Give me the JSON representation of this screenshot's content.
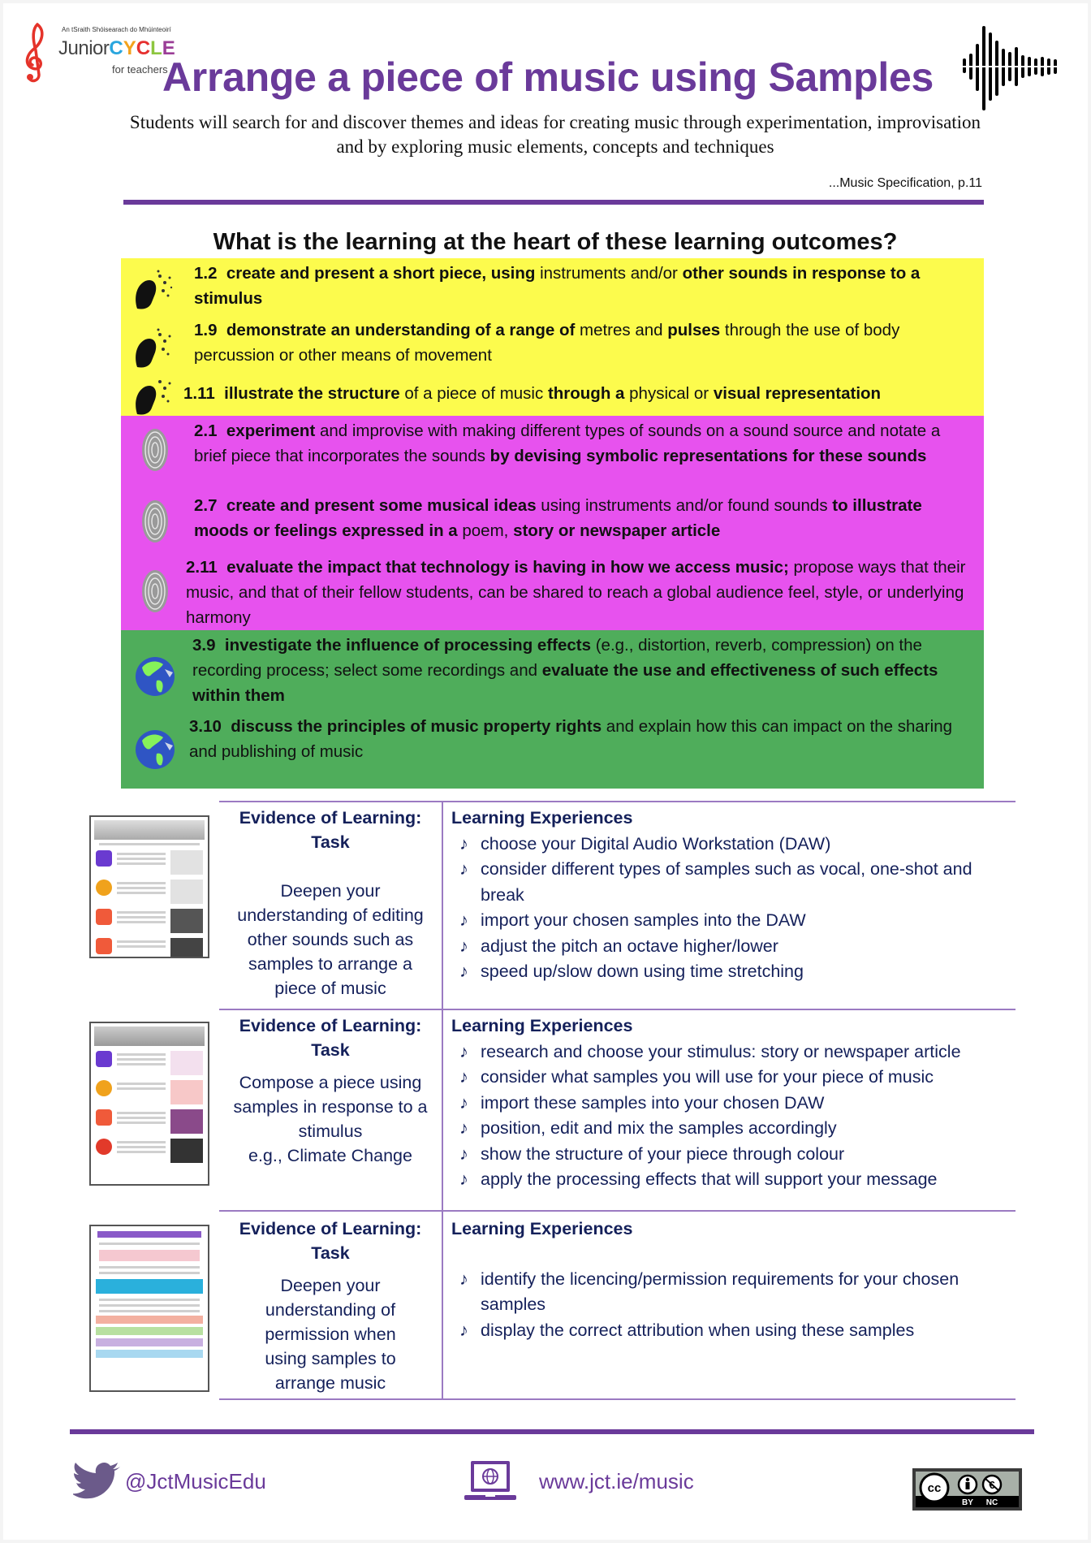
{
  "header": {
    "logo": {
      "irish_line": "An tSraith Shóisearach do Mhúinteoirí",
      "junior": "Junior",
      "cycle_letters": [
        "C",
        "Y",
        "C",
        "L",
        "E"
      ],
      "for_teachers": "for teachers"
    },
    "title": "Arrange a piece of music using Samples",
    "subtitle": "Students will search for and discover themes and ideas for creating music through experimentation, improvisation and by exploring music elements, concepts and techniques",
    "citation": "...Music Specification, p.11"
  },
  "question": "What is the learning at the heart of these learning outcomes?",
  "colors": {
    "brand_purple": "#6a3a9a",
    "strand1_yellow": "#fcfb4d",
    "strand2_pink": "#e752ee",
    "strand3_green": "#4fad5b",
    "table_text_navy": "#14205a",
    "table_rule_lilac": "#9b7ac2"
  },
  "outcomes": [
    {
      "strand": 1,
      "icon": "head-music-icon",
      "number": "1.2",
      "segments": [
        {
          "t": "create and present a short piece, using",
          "b": true
        },
        {
          "t": " instruments and/or ",
          "b": false
        },
        {
          "t": "other sounds in response to a stimulus",
          "b": true
        }
      ]
    },
    {
      "strand": 1,
      "icon": "head-music-icon",
      "number": "1.9",
      "segments": [
        {
          "t": "demonstrate an understanding of a range of",
          "b": true
        },
        {
          "t": " metres and ",
          "b": false
        },
        {
          "t": "pulses",
          "b": true
        },
        {
          "t": " through the use of body percussion or other means of movement",
          "b": false
        }
      ]
    },
    {
      "strand": 1,
      "icon": "head-music-icon",
      "number": "1.11",
      "segments": [
        {
          "t": "illustrate the structure",
          "b": true
        },
        {
          "t": " of a piece of music ",
          "b": false
        },
        {
          "t": "through a",
          "b": true
        },
        {
          "t": " physical or ",
          "b": false
        },
        {
          "t": "visual representation",
          "b": true
        }
      ]
    },
    {
      "strand": 2,
      "icon": "fingerprint-icon",
      "number": "2.1",
      "segments": [
        {
          "t": "experiment",
          "b": true
        },
        {
          "t": " and improvise with making different types of sounds on a sound source and notate a brief piece that incorporates the sounds ",
          "b": false
        },
        {
          "t": "by devising symbolic representations for these sounds",
          "b": true
        }
      ]
    },
    {
      "strand": 2,
      "icon": "fingerprint-icon",
      "number": "2.7",
      "segments": [
        {
          "t": "create and present some musical ideas",
          "b": true
        },
        {
          "t": " using instruments and/or found sounds ",
          "b": false
        },
        {
          "t": "to illustrate moods or feelings expressed in a",
          "b": true
        },
        {
          "t": " poem, ",
          "b": false
        },
        {
          "t": "story or newspaper article",
          "b": true
        }
      ]
    },
    {
      "strand": 2,
      "icon": "fingerprint-icon",
      "number": "2.11",
      "segments": [
        {
          "t": "evaluate the impact that technology is having in how we access music;",
          "b": true
        },
        {
          "t": " propose ways that their music, and that of their fellow students, can be shared to reach a global audience feel, style, or underlying harmony",
          "b": false
        }
      ]
    },
    {
      "strand": 3,
      "icon": "globe-icon",
      "number": "3.9",
      "segments": [
        {
          "t": "investigate the influence of processing effects",
          "b": true
        },
        {
          "t": " (e.g., distortion, reverb, compression) on the recording process; select some recordings and ",
          "b": false
        },
        {
          "t": "evaluate the use and effectiveness of such effects within them",
          "b": true
        }
      ]
    },
    {
      "strand": 3,
      "icon": "globe-icon",
      "number": "3.10",
      "segments": [
        {
          "t": "discuss the principles of music property rights",
          "b": true
        },
        {
          "t": " and explain how this can impact on the sharing and publishing of music",
          "b": false
        }
      ]
    }
  ],
  "table": {
    "task_header": "Evidence of Learning: Task",
    "task_header_line1": "Evidence of Learning:",
    "task_header_line2": "Task",
    "experiences_header": "Learning Experiences",
    "bullet_glyph": "♪",
    "rows": [
      {
        "thumbnail": "Editing Samples handout",
        "task": "Deepen your understanding of editing other sounds such as samples to arrange a piece of music",
        "experiences": [
          "choose your Digital Audio Workstation (DAW)",
          "consider different types of samples such as vocal, one-shot and break",
          "import your chosen samples into the DAW",
          "adjust the pitch an octave higher/lower",
          "speed up/slow down using time stretching"
        ]
      },
      {
        "thumbnail": "Illustrate Structure Through Visual Representation handout",
        "task": "Compose a piece using samples in response to a stimulus e.g., Climate Change",
        "task_line1": "Compose a piece using samples in response to a stimulus",
        "task_line2": "e.g., Climate Change",
        "experiences": [
          "research and choose your stimulus: story or newspaper article",
          "consider what samples you will use for your piece of music",
          "import these samples into your chosen DAW",
          "position, edit and mix the samples accordingly",
          "show the structure of your piece through colour",
          "apply the processing effects that will support your message"
        ]
      },
      {
        "thumbnail": "Creative Commons Licencing handout",
        "task": "Deepen your understanding of permission when using samples to arrange music",
        "experiences": [
          "identify the licencing/permission requirements for your chosen samples",
          "display the correct attribution when using these samples"
        ]
      }
    ]
  },
  "footer": {
    "twitter_handle": "@JctMusicEdu",
    "website": "www.jct.ie/music",
    "license_labels": [
      "BY",
      "NC"
    ],
    "license_mark": "cc"
  }
}
